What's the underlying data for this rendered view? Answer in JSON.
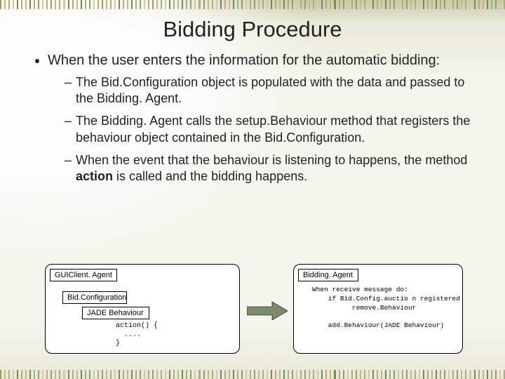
{
  "title": "Bidding Procedure",
  "bullets": {
    "main": "When the user enters the information for the automatic bidding:",
    "sub1": "The Bid.Configuration object is populated with the data and passed to the Bidding. Agent.",
    "sub2": "The Bidding. Agent calls the setup.Behaviour method that registers the behaviour object contained in the Bid.Configuration.",
    "sub3_a": "When the event that the behaviour is listening to happens, the method ",
    "sub3_b": "action",
    "sub3_c": " is called and the bidding happens."
  },
  "diagram": {
    "left": {
      "gui_box": "GUIClient. Agent",
      "conf_box": "Bid.Configuration",
      "beh_box": "JADE Behaviour",
      "code": "action() {\n  ....\n}"
    },
    "right": {
      "box": "Bidding. Agent",
      "code": "When receive message do:\n    if Bid.Config.auctio n registered\n          remove.Behaviour\n\n    add.Behaviour(JADE Behaviour)"
    }
  }
}
